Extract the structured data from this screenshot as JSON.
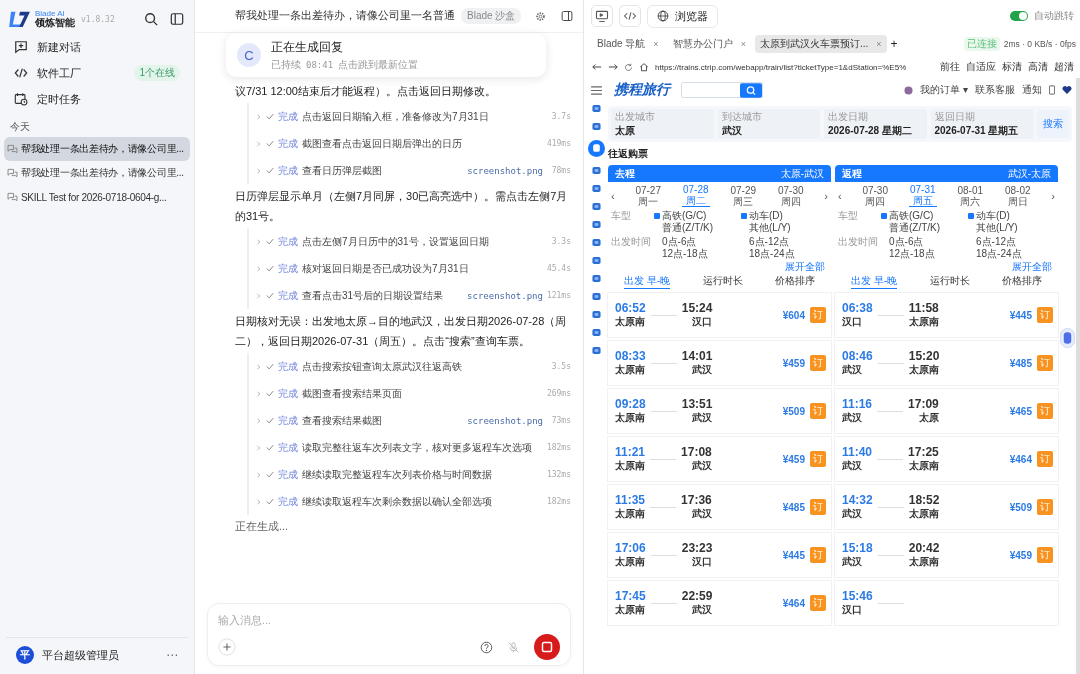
{
  "sidebar": {
    "brand_small": "Blade AI",
    "brand": "领炼智能",
    "version": "v1.8.32",
    "nav": [
      {
        "label": "新建对话"
      },
      {
        "label": "软件工厂",
        "badge": "1个在线"
      },
      {
        "label": "定时任务"
      }
    ],
    "section": "今天",
    "chats": [
      {
        "title": "帮我处理一条出差待办，请像公司里...",
        "selected": true
      },
      {
        "title": "帮我处理一条出差待办，请像公司里...",
        "selected": false
      },
      {
        "title": "SKILL Test for 2026-0718-0604-g...",
        "selected": false
      }
    ],
    "user": {
      "avatar": "平",
      "name": "平台超级管理员",
      "more": "⋯"
    }
  },
  "chat": {
    "title": "帮我处理一条出差待办，请像公司里一名普通",
    "badge": "Blade 沙盒",
    "status_card": {
      "avatar": "C",
      "title": "正在生成回复",
      "elapsed_label": "已持续",
      "elapsed": "08:41",
      "link": "点击跳到最新位置"
    },
    "blocks": [
      {
        "kind": "text",
        "text": "议7/31 12:00结束后才能返程）。点击返回日期修改。"
      },
      {
        "kind": "steps",
        "steps": [
          {
            "status": "完成",
            "done": true,
            "text": "点击返回日期输入框，准备修改为7月31日",
            "duration": "3.7s"
          },
          {
            "status": "完成",
            "done": true,
            "text": "截图查看点击返回日期后弹出的日历",
            "duration": "419ms"
          },
          {
            "status": "完成",
            "done": true,
            "text": "查看日历弹层截图",
            "file": "screenshot.png",
            "duration": "78ms"
          }
        ]
      },
      {
        "kind": "text",
        "text": "日历弹层显示单月（左侧7月同屏，30已高亮选中）。需点击左侧7月的31号。"
      },
      {
        "kind": "steps",
        "steps": [
          {
            "status": "完成",
            "done": true,
            "text": "点击左侧7月日历中的31号，设置返回日期",
            "duration": "3.3s"
          },
          {
            "status": "完成",
            "done": true,
            "text": "核对返回日期是否已成功设为7月31日",
            "duration": "45.4s"
          },
          {
            "status": "完成",
            "done": true,
            "text": "查看点击31号后的日期设置结果",
            "file": "screenshot.png",
            "duration": "121ms"
          }
        ]
      },
      {
        "kind": "text",
        "text": "日期核对无误：出发地太原→目的地武汉，出发日期2026-07-28（周二），返回日期2026-07-31（周五）。点击“搜索”查询车票。"
      },
      {
        "kind": "steps",
        "steps": [
          {
            "status": "完成",
            "done": true,
            "text": "点击搜索按钮查询太原武汉往返高铁",
            "duration": "3.5s"
          },
          {
            "status": "完成",
            "done": true,
            "text": "截图查看搜索结果页面",
            "duration": "269ms"
          },
          {
            "status": "完成",
            "done": true,
            "text": "查看搜索结果截图",
            "file": "screenshot.png",
            "duration": "73ms"
          },
          {
            "status": "完成",
            "done": true,
            "text": "读取完整往返车次列表文字，核对更多返程车次选项",
            "duration": "182ms"
          },
          {
            "status": "完成",
            "done": true,
            "text": "继续读取完整返程车次列表价格与时间数据",
            "duration": "132ms"
          },
          {
            "status": "完成",
            "done": true,
            "text": "继续读取返程车次剩余数据以确认全部选项",
            "duration": "182ms"
          }
        ]
      }
    ],
    "generating": "正在生成...",
    "input": {
      "placeholder": "输入消息..."
    }
  },
  "browser": {
    "view_label": "浏览器",
    "auto_follow": {
      "label": "自动跳转",
      "on": true
    },
    "tabs": [
      {
        "title": "Blade 导航",
        "close": "×",
        "selected": false
      },
      {
        "title": "智慧办公门户",
        "close": "×",
        "selected": false
      },
      {
        "title": "太原到武汉火车票预订...",
        "close": "×",
        "selected": true
      }
    ],
    "new_tab": "+",
    "connection": "已连接",
    "stats": "2ms · 0 KB/s · 0fps",
    "url": "https://trains.ctrip.com/webapp/train/list?ticketType=1&dStation=%E5%",
    "url_actions": [
      "前往",
      "自适应",
      "标清",
      "高清",
      "超清"
    ],
    "site": {
      "logo": "携程旅行",
      "header_links": [
        "我的订单 ▾",
        "联系客服",
        "通知"
      ],
      "rail": [
        {
          "selected": false
        },
        {
          "selected": false
        },
        {
          "selected": true
        },
        {
          "selected": false
        },
        {
          "selected": false
        },
        {
          "selected": false
        },
        {
          "selected": false
        },
        {
          "selected": false
        },
        {
          "selected": false
        },
        {
          "selected": false
        },
        {
          "selected": false
        },
        {
          "selected": false
        },
        {
          "selected": false
        },
        {
          "selected": false
        }
      ],
      "form": [
        {
          "label": "出发城市",
          "value": "太原"
        },
        {
          "label": "到达城市",
          "value": "武汉"
        },
        {
          "label": "出发日期",
          "value": "2026-07-28",
          "weekday": "星期二"
        },
        {
          "label": "返回日期",
          "value": "2026-07-31",
          "weekday": "星期五"
        }
      ],
      "search_button": "搜索",
      "section": "往返购票",
      "legs": [
        {
          "title": "去程",
          "route": "太原-武汉",
          "prev": "‹",
          "next": "›",
          "dates": [
            {
              "date": "07-27",
              "weekday": "周一",
              "selected": false
            },
            {
              "date": "07-28",
              "weekday": "周二",
              "selected": true
            },
            {
              "date": "07-29",
              "weekday": "周三",
              "selected": false
            },
            {
              "date": "07-30",
              "weekday": "周四",
              "selected": false
            }
          ],
          "filters": [
            {
              "label": "车型",
              "options": [
                {
                  "label": "高铁(G/C)",
                  "checked": true
                },
                {
                  "label": "动车(D)",
                  "checked": true
                },
                {
                  "label": "普通(Z/T/K)",
                  "checked": false
                },
                {
                  "label": "其他(L/Y)",
                  "checked": false
                }
              ]
            },
            {
              "label": "出发时间",
              "options": [
                {
                  "label": "0点-6点",
                  "checked": false
                },
                {
                  "label": "6点-12点",
                  "checked": false
                },
                {
                  "label": "12点-18点",
                  "checked": false
                },
                {
                  "label": "18点-24点",
                  "checked": false
                }
              ]
            }
          ],
          "expand": "展开全部",
          "sorts": [
            {
              "label": "出发 早-晚",
              "selected": true
            },
            {
              "label": "运行时长",
              "selected": false
            },
            {
              "label": "价格排序",
              "selected": false
            }
          ],
          "trains": [
            {
              "depart": "06:52",
              "from": "太原南",
              "arrive": "15:24",
              "to": "汉口",
              "price": "¥604",
              "book": "订"
            },
            {
              "depart": "08:33",
              "from": "太原南",
              "arrive": "14:01",
              "to": "武汉",
              "price": "¥459",
              "book": "订"
            },
            {
              "depart": "09:28",
              "from": "太原南",
              "arrive": "13:51",
              "to": "武汉",
              "price": "¥509",
              "book": "订"
            },
            {
              "depart": "11:21",
              "from": "太原南",
              "arrive": "17:08",
              "to": "武汉",
              "price": "¥459",
              "book": "订"
            },
            {
              "depart": "11:35",
              "from": "太原南",
              "arrive": "17:36",
              "to": "武汉",
              "price": "¥485",
              "book": "订"
            },
            {
              "depart": "17:06",
              "from": "太原南",
              "arrive": "23:23",
              "to": "汉口",
              "price": "¥445",
              "book": "订"
            },
            {
              "depart": "17:45",
              "from": "太原南",
              "arrive": "22:59",
              "to": "武汉",
              "price": "¥464",
              "book": "订"
            }
          ]
        },
        {
          "title": "返程",
          "route": "武汉-太原",
          "prev": "‹",
          "next": "›",
          "dates": [
            {
              "date": "07-30",
              "weekday": "周四",
              "selected": false
            },
            {
              "date": "07-31",
              "weekday": "周五",
              "selected": true
            },
            {
              "date": "08-01",
              "weekday": "周六",
              "selected": false
            },
            {
              "date": "08-02",
              "weekday": "周日",
              "selected": false
            }
          ],
          "filters": [
            {
              "label": "车型",
              "options": [
                {
                  "label": "高铁(G/C)",
                  "checked": true
                },
                {
                  "label": "动车(D)",
                  "checked": true
                },
                {
                  "label": "普通(Z/T/K)",
                  "checked": false
                },
                {
                  "label": "其他(L/Y)",
                  "checked": false
                }
              ]
            },
            {
              "label": "出发时间",
              "options": [
                {
                  "label": "0点-6点",
                  "checked": false
                },
                {
                  "label": "6点-12点",
                  "checked": false
                },
                {
                  "label": "12点-18点",
                  "checked": false
                },
                {
                  "label": "18点-24点",
                  "checked": false
                }
              ]
            }
          ],
          "expand": "展开全部",
          "sorts": [
            {
              "label": "出发 早-晚",
              "selected": true
            },
            {
              "label": "运行时长",
              "selected": false
            },
            {
              "label": "价格排序",
              "selected": false
            }
          ],
          "trains": [
            {
              "depart": "06:38",
              "from": "汉口",
              "arrive": "11:58",
              "to": "太原南",
              "price": "¥445",
              "book": "订"
            },
            {
              "depart": "08:46",
              "from": "武汉",
              "arrive": "15:20",
              "to": "太原南",
              "price": "¥485",
              "book": "订"
            },
            {
              "depart": "11:16",
              "from": "武汉",
              "arrive": "17:09",
              "to": "太原",
              "price": "¥465",
              "book": "订"
            },
            {
              "depart": "11:40",
              "from": "武汉",
              "arrive": "17:25",
              "to": "太原南",
              "price": "¥464",
              "book": "订"
            },
            {
              "depart": "14:32",
              "from": "武汉",
              "arrive": "18:52",
              "to": "太原南",
              "price": "¥509",
              "book": "订"
            },
            {
              "depart": "15:18",
              "from": "武汉",
              "arrive": "20:42",
              "to": "太原南",
              "price": "¥459",
              "book": "订"
            },
            {
              "depart": "15:46",
              "from": "汉口"
            }
          ]
        }
      ]
    }
  }
}
